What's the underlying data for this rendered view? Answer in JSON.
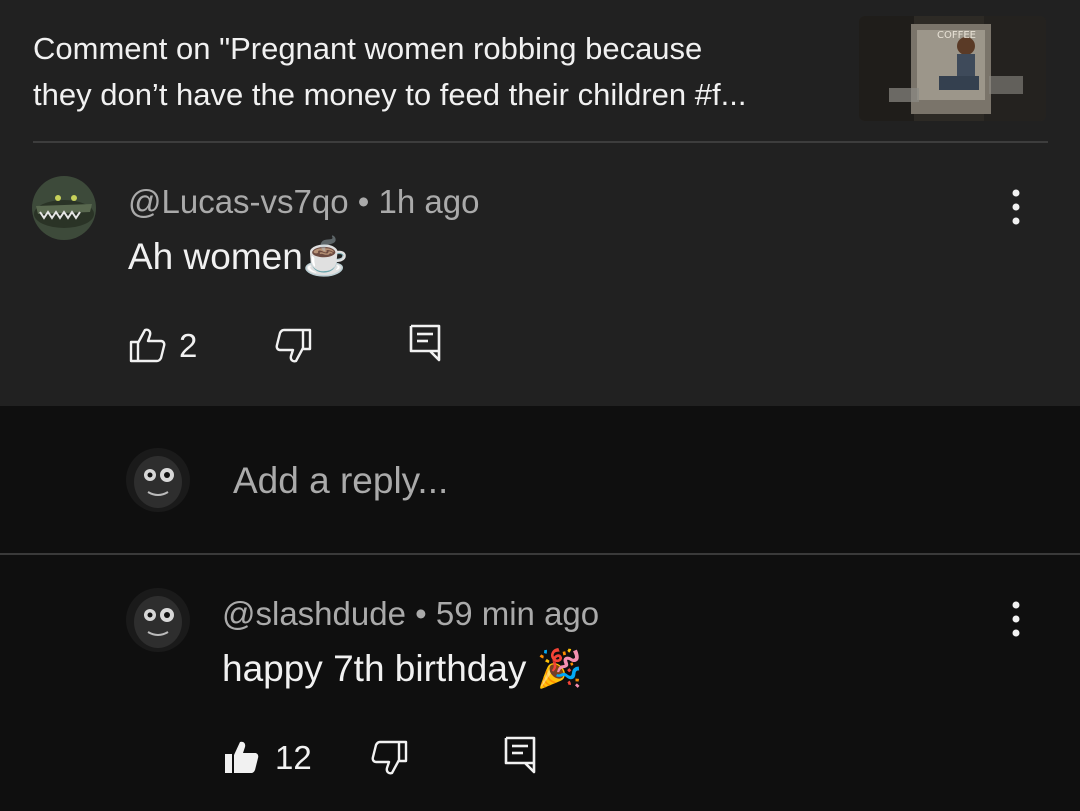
{
  "header": {
    "title": "Comment on \"Pregnant women robbing because they don’t have the money to feed their children #f...\"",
    "title_line1": "Comment on \"Pregnant women robbing because",
    "title_line2": "they don’t have the money to feed their children #f...",
    "thumb_sign_text": "COFFEE"
  },
  "comment": {
    "author": "@Lucas-vs7qo",
    "time": "1h ago",
    "separator": "•",
    "text": "Ah women",
    "emoji": "☕",
    "like_count": "2"
  },
  "reply_box": {
    "placeholder": "Add a reply..."
  },
  "reply": {
    "author": "@slashdude",
    "time": "59 min ago",
    "separator": "•",
    "text": "happy 7th birthday",
    "emoji": "🎉",
    "like_count": "12"
  },
  "colors": {
    "header_bg": "#212121",
    "page_bg": "#0f0f0f",
    "text_primary": "#f1f1f1",
    "text_secondary": "#aaaaaa"
  }
}
